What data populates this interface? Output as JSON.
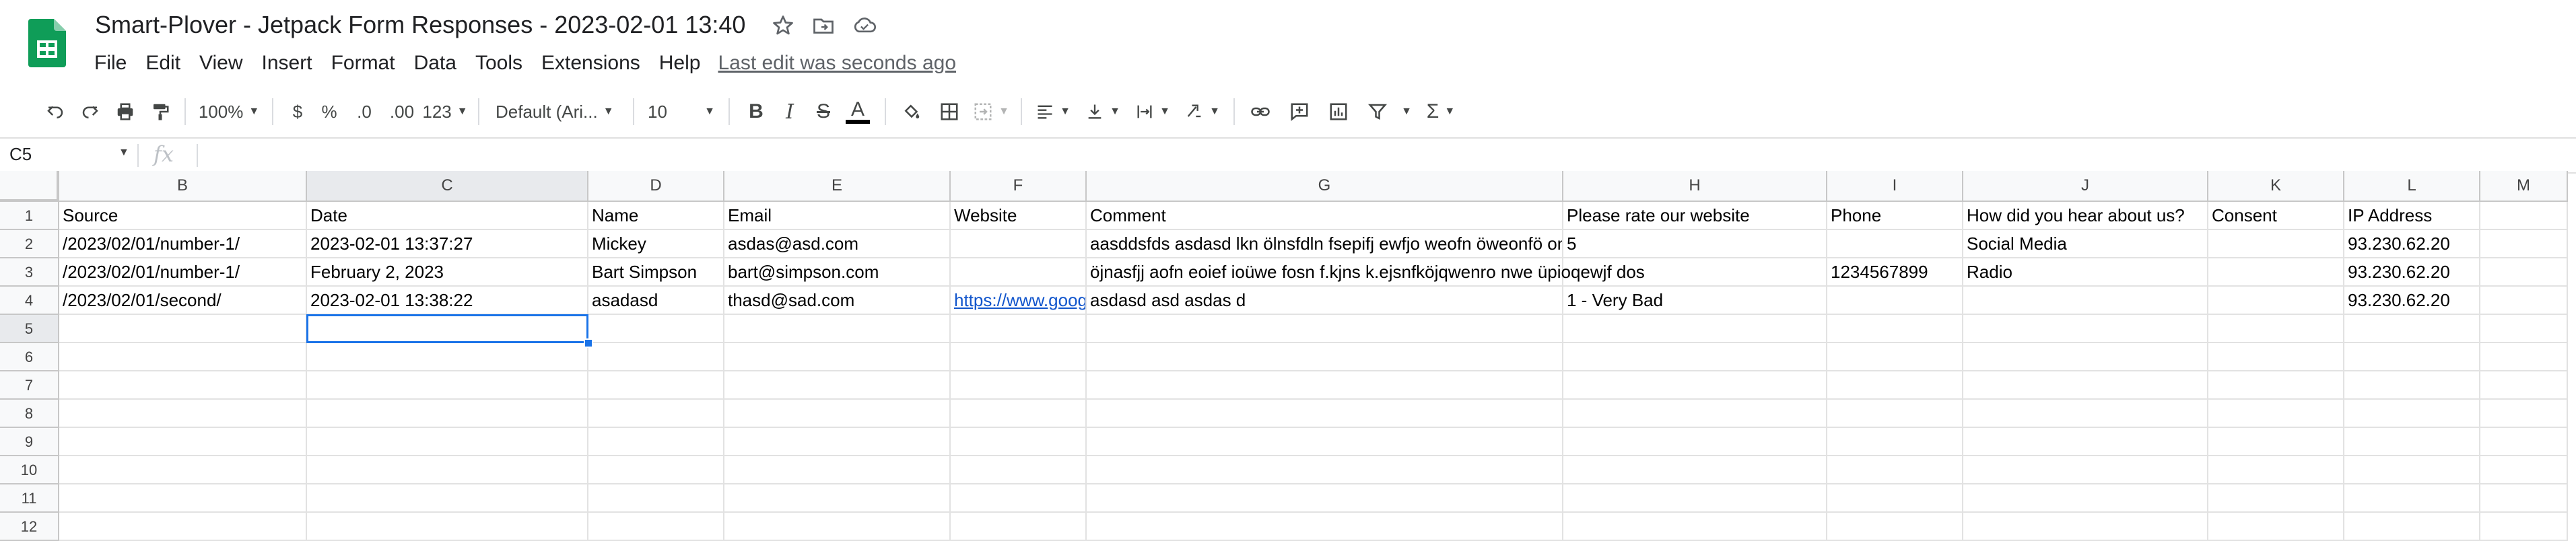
{
  "document": {
    "title": "Smart-Plover - Jetpack Form Responses - 2023-02-01 13:40",
    "icons": [
      "star-icon",
      "move-to-folder-icon",
      "cloud-saved-icon"
    ]
  },
  "menu": {
    "items": [
      "File",
      "Edit",
      "View",
      "Insert",
      "Format",
      "Data",
      "Tools",
      "Extensions",
      "Help"
    ],
    "last_edit": "Last edit was seconds ago"
  },
  "toolbar": {
    "zoom": "100%",
    "currency": "$",
    "percent": "%",
    "decrease_decimal": ".0",
    "increase_decimal": ".00",
    "more_formats": "123",
    "font": "Default (Ari...",
    "font_size": "10",
    "bold": "B",
    "italic": "I",
    "strike": "S",
    "text_color": "A",
    "sum": "Σ"
  },
  "formula_bar": {
    "cell_ref": "C5",
    "fx": "fx",
    "content": ""
  },
  "grid": {
    "columns": [
      "B",
      "C",
      "D",
      "E",
      "F",
      "G",
      "H",
      "I",
      "J",
      "K",
      "L",
      "M"
    ],
    "row_numbers": [
      "1",
      "2",
      "3",
      "4",
      "5",
      "6",
      "7",
      "8",
      "9",
      "10",
      "11",
      "12"
    ],
    "active_column": "C",
    "active_row": "5",
    "rows": [
      [
        "Source",
        "Date",
        "Name",
        "Email",
        "Website",
        "Comment",
        "Please rate our website",
        "Phone",
        "How did you hear about us?",
        "Consent",
        "IP Address",
        ""
      ],
      [
        "/2023/02/01/number-1/",
        "2023-02-01 13:37:27",
        "Mickey",
        "asdas@asd.com",
        "",
        "aasddsfds asdasd lkn ölnsfdln fsepifj ewfjo weofn öweonfö onfoewijf owepi eipwf oeiwj cpwej",
        "5",
        "",
        "Social Media",
        "",
        "93.230.62.20",
        ""
      ],
      [
        "/2023/02/01/number-1/",
        "February 2, 2023",
        "Bart Simpson",
        "bart@simpson.com",
        "",
        "öjnasfjj aofn eoief ioüwe fosn f.kjns k.ejsnfköjqwenro nwe üpioqewjf dos",
        "",
        "1234567899",
        "Radio",
        "",
        "93.230.62.20",
        ""
      ],
      [
        "/2023/02/01/second/",
        "2023-02-01 13:38:22",
        "asadasd",
        "thasd@sad.com",
        "https://www.goog",
        "asdasd asd asdas d",
        "1 - Very Bad",
        "",
        "",
        "",
        "93.230.62.20",
        ""
      ]
    ]
  },
  "colors": {
    "accent": "#1a73e8",
    "link": "#1155cc",
    "sheets_green": "#0f9d58"
  }
}
